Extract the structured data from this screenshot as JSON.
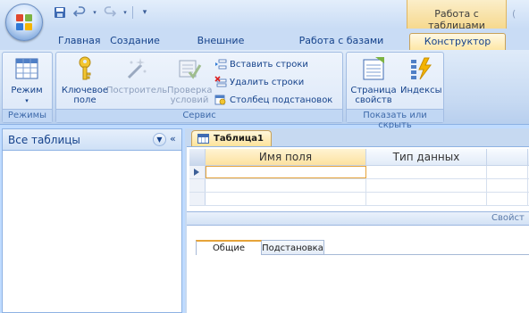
{
  "window": {
    "context_title": "Работа с таблицами",
    "context_title_tail": "("
  },
  "qat": {
    "save_icon": "save-icon",
    "undo_icon": "undo-icon",
    "redo_icon": "redo-icon",
    "customize_icon": "customize-arrow-icon"
  },
  "ribbon_tabs": [
    {
      "label": "Главная",
      "active": false
    },
    {
      "label": "Создание",
      "active": false
    },
    {
      "label": "Внешние данные",
      "active": false
    },
    {
      "label": "Работа с базами данных",
      "active": false
    },
    {
      "label": "Конструктор",
      "active": true
    }
  ],
  "groups": {
    "views": {
      "label": "Режимы",
      "view_button": "Режим"
    },
    "tools": {
      "label": "Сервис",
      "primary_key_l1": "Ключевое",
      "primary_key_l2": "поле",
      "builder": "Построитель",
      "test_rules_l1": "Проверка",
      "test_rules_l2": "условий",
      "insert_rows": "Вставить строки",
      "delete_rows": "Удалить строки",
      "lookup_column": "Столбец подстановок"
    },
    "show_hide": {
      "label": "Показать или скрыть",
      "property_sheet_l1": "Страница",
      "property_sheet_l2": "свойств",
      "indexes": "Индексы"
    }
  },
  "nav_pane": {
    "title": "Все таблицы",
    "collapse_glyph": "«"
  },
  "document": {
    "tab_label": "Таблица1",
    "columns": [
      "Имя поля",
      "Тип данных",
      ""
    ],
    "rows": [
      {
        "field_name": "",
        "data_type": "",
        "description": "",
        "current": true
      },
      {
        "field_name": "",
        "data_type": "",
        "description": "",
        "current": false
      },
      {
        "field_name": "",
        "data_type": "",
        "description": "",
        "current": false
      }
    ],
    "properties_label": "Свойст",
    "property_tabs": [
      "Общие",
      "Подстановка"
    ]
  },
  "colors": {
    "ribbon_bg": "#dfebf9",
    "accent": "#15428b",
    "context_tab": "#f6d98e",
    "selection_outline": "#e6a339"
  }
}
